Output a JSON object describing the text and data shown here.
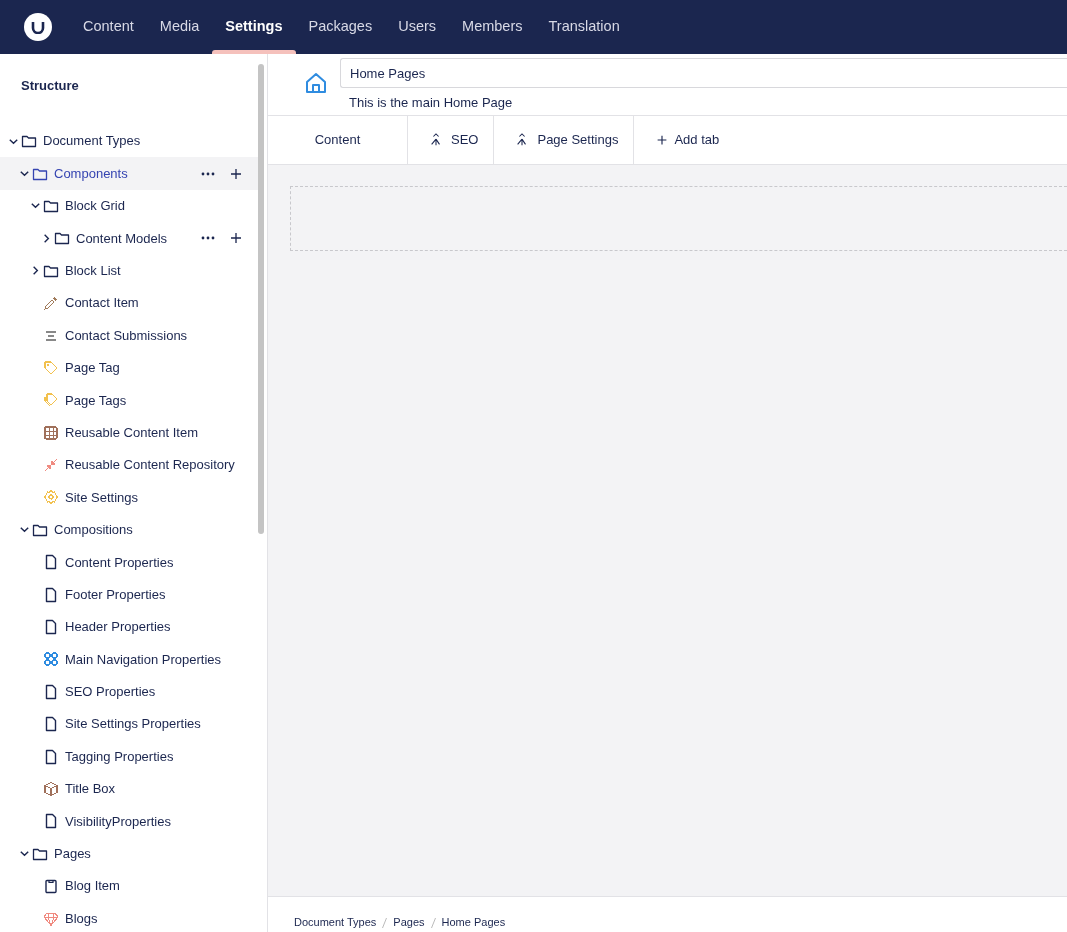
{
  "top_nav": {
    "items": [
      {
        "label": "Content",
        "selected": false
      },
      {
        "label": "Media",
        "selected": false
      },
      {
        "label": "Settings",
        "selected": true
      },
      {
        "label": "Packages",
        "selected": false
      },
      {
        "label": "Users",
        "selected": false
      },
      {
        "label": "Members",
        "selected": false
      },
      {
        "label": "Translation",
        "selected": false
      }
    ]
  },
  "sidebar": {
    "title": "Structure",
    "tree": [
      {
        "label": "Document Types",
        "kind": "folder",
        "expanded": true,
        "selected": false,
        "children": [
          {
            "label": "Components",
            "kind": "folder",
            "expanded": true,
            "selected": true,
            "show_actions": true,
            "children": [
              {
                "label": "Block Grid",
                "kind": "folder",
                "expanded": true,
                "selected": false,
                "children": [
                  {
                    "label": "Content Models",
                    "kind": "folder",
                    "expanded": false,
                    "selected": false,
                    "show_actions": true
                  }
                ]
              },
              {
                "label": "Block List",
                "kind": "folder",
                "expanded": false,
                "selected": false
              },
              {
                "label": "Contact Item",
                "kind": "pipette",
                "color": "#a07a5a",
                "selected": false
              },
              {
                "label": "Contact Submissions",
                "kind": "lines",
                "color": "#888888",
                "selected": false
              },
              {
                "label": "Page Tag",
                "kind": "tag",
                "color": "#f2c14e",
                "selected": false
              },
              {
                "label": "Page Tags",
                "kind": "tags",
                "color": "#f2c14e",
                "selected": false
              },
              {
                "label": "Reusable Content Item",
                "kind": "grid",
                "color": "#a0705a",
                "selected": false
              },
              {
                "label": "Reusable Content Repository",
                "kind": "arrows",
                "color": "#f08a80",
                "selected": false
              },
              {
                "label": "Site Settings",
                "kind": "gear",
                "color": "#f2c14e",
                "selected": false
              }
            ]
          },
          {
            "label": "Compositions",
            "kind": "folder",
            "expanded": true,
            "selected": false,
            "children": [
              {
                "label": "Content Properties",
                "kind": "document",
                "selected": false
              },
              {
                "label": "Footer Properties",
                "kind": "document",
                "selected": false
              },
              {
                "label": "Header Properties",
                "kind": "document",
                "selected": false
              },
              {
                "label": "Main Navigation Properties",
                "kind": "apps",
                "color": "#2f8ce0",
                "selected": false
              },
              {
                "label": "SEO Properties",
                "kind": "document",
                "selected": false
              },
              {
                "label": "Site Settings Properties",
                "kind": "document",
                "selected": false
              },
              {
                "label": "Tagging Properties",
                "kind": "document",
                "selected": false
              },
              {
                "label": "Title Box",
                "kind": "box",
                "color": "#a0705a",
                "selected": false
              },
              {
                "label": "VisibilityProperties",
                "kind": "document",
                "selected": false
              }
            ]
          },
          {
            "label": "Pages",
            "kind": "folder",
            "expanded": true,
            "selected": false,
            "children": [
              {
                "label": "Blog Item",
                "kind": "clipboard",
                "selected": false
              },
              {
                "label": "Blogs",
                "kind": "gem",
                "color": "#f08a80",
                "selected": false
              }
            ]
          }
        ]
      }
    ]
  },
  "editor": {
    "name": "Home Pages",
    "description": "This is the main Home Page",
    "tabs": [
      {
        "label": "Content",
        "kind": "plain",
        "selected": false
      },
      {
        "label": "SEO",
        "kind": "composition",
        "selected": false
      },
      {
        "label": "Page Settings",
        "kind": "composition",
        "selected": false
      },
      {
        "label": "Add tab",
        "kind": "add",
        "selected": false
      }
    ]
  },
  "breadcrumb": [
    "Document Types",
    "Pages",
    "Home Pages"
  ]
}
